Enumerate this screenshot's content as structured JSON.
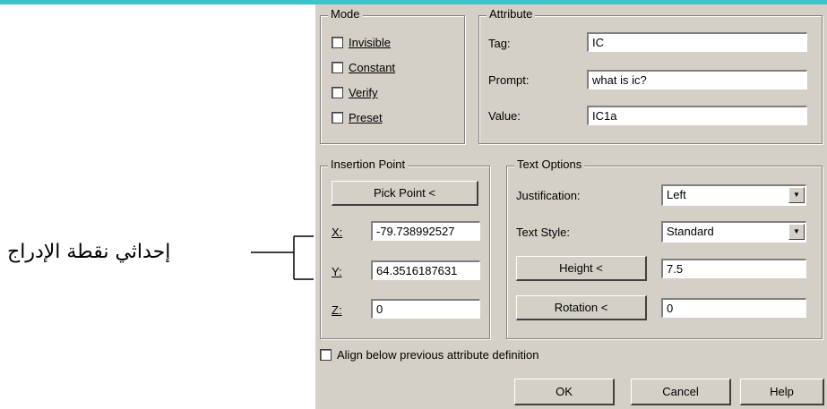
{
  "annotation": {
    "text": "إحداثي نقطة الإدراج"
  },
  "mode": {
    "legend": "Mode",
    "items": [
      {
        "label": "Invisible"
      },
      {
        "label": "Constant"
      },
      {
        "label": "Verify"
      },
      {
        "label": "Preset"
      }
    ]
  },
  "attribute": {
    "legend": "Attribute",
    "tag_label": "Tag:",
    "tag_value": "IC",
    "prompt_label": "Prompt:",
    "prompt_value": "what is ic?",
    "value_label": "Value:",
    "value_value": "IC1a"
  },
  "insertion": {
    "legend": "Insertion Point",
    "pick_button": "Pick Point <",
    "x_label": "X:",
    "x_value": "-79.738992527",
    "y_label": "Y:",
    "y_value": "64.3516187631",
    "z_label": "Z:",
    "z_value": "0"
  },
  "text_options": {
    "legend": "Text Options",
    "justification_label": "Justification:",
    "justification_value": "Left",
    "style_label": "Text Style:",
    "style_value": "Standard",
    "height_button": "Height <",
    "height_value": "7.5",
    "rotation_button": "Rotation <",
    "rotation_value": "0"
  },
  "align": {
    "label": "Align below previous attribute definition"
  },
  "buttons": {
    "ok": "OK",
    "cancel": "Cancel",
    "help": "Help"
  }
}
